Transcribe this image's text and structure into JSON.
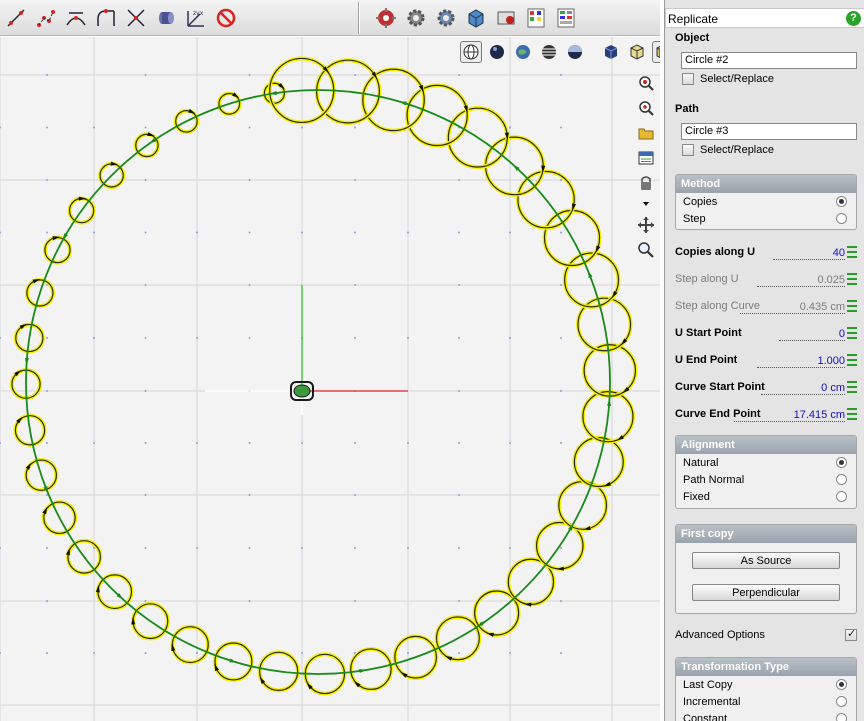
{
  "toolbar": {
    "left_tools": [
      "curve-add-point-icon",
      "curve-points-icon",
      "curve-split-icon",
      "curve-bridge-icon",
      "curve-trim-icon",
      "extrude-tube-icon",
      "axis-xyz-icon",
      "no-entry-icon"
    ],
    "right_tools": [
      "render-icon",
      "settings-gear-icon",
      "scene-gear-icon",
      "textured-cube-icon",
      "render-region-icon",
      "palette-grid-icon",
      "layers-grid-icon"
    ]
  },
  "viewport": {
    "view_modes": [
      "perspective-view-icon",
      "sphere-shaded-icon",
      "globe-shaded-icon",
      "striped-sphere-icon",
      "half-shaded-sphere-icon",
      "solid-cube-icon",
      "wire-cube-icon",
      "textured-cube-icon"
    ],
    "side_tools": [
      "zoom-window-icon",
      "zoom-fit-icon",
      "folder-icon",
      "layer-stack-icon",
      "lock-icon",
      "dropdown-arrow-icon",
      "move-arrows-icon",
      "magnifier-icon"
    ],
    "colors": {
      "path": "#1a8a1a",
      "copy_stroke": "#2a2a1a",
      "copy_highlight": "#f5f000",
      "axis_x": "#e02020",
      "axis_y": "#20c020",
      "grid": "#d6d6d6",
      "grid_dot": "#9a9ad8"
    }
  },
  "panel": {
    "title": "Replicate",
    "help_label": "?",
    "object": {
      "heading": "Object",
      "value": "Circle #2",
      "select_replace_label": "Select/Replace",
      "select_replace_checked": false
    },
    "path": {
      "heading": "Path",
      "value": "Circle #3",
      "select_replace_label": "Select/Replace",
      "select_replace_checked": false
    },
    "method": {
      "heading": "Method",
      "options": [
        "Copies",
        "Step"
      ],
      "selected": "Copies"
    },
    "params": [
      {
        "label": "Copies along U",
        "value": "40",
        "enabled": true
      },
      {
        "label": "Step along U",
        "value": "0.025",
        "enabled": false
      },
      {
        "label": "Step along Curve",
        "value": "0.435 cm",
        "enabled": false
      },
      {
        "label": "U Start Point",
        "value": "0",
        "enabled": true
      },
      {
        "label": "U End Point",
        "value": "1.000",
        "enabled": true
      },
      {
        "label": "Curve Start Point",
        "value": "0 cm",
        "enabled": true
      },
      {
        "label": "Curve End Point",
        "value": "17.415 cm",
        "enabled": true
      }
    ],
    "alignment": {
      "heading": "Alignment",
      "options": [
        "Natural",
        "Path Normal",
        "Fixed"
      ],
      "selected": "Natural"
    },
    "first_copy": {
      "heading": "First copy",
      "buttons": [
        "As Source",
        "Perpendicular"
      ]
    },
    "advanced_options": {
      "label": "Advanced Options",
      "checked": true
    },
    "transformation_type": {
      "heading": "Transformation Type",
      "options": [
        "Last Copy",
        "Incremental",
        "Constant"
      ],
      "selected": "Last Copy"
    }
  }
}
